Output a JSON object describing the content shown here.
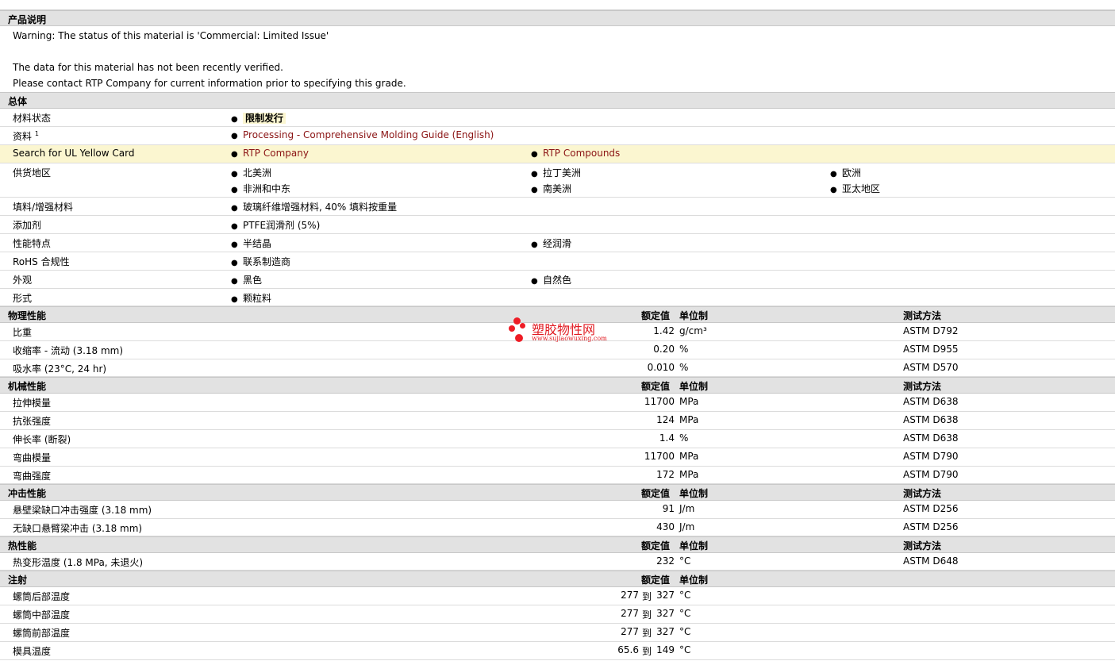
{
  "desc": {
    "title": "产品说明",
    "warning": "Warning: The status of this material is 'Commercial: Limited Issue'",
    "line2": "The data for this material has not been recently verified.",
    "line3": "Please contact RTP Company for current information prior to specifying this grade."
  },
  "general": {
    "title": "总体",
    "status_label": "材料状态",
    "status_value": "限制发行",
    "docs_label": "资料",
    "docs_sup": "1",
    "docs_link": "Processing - Comprehensive Molding Guide (English)",
    "ul_label": "Search for UL Yellow Card",
    "ul_link1": "RTP Company",
    "ul_link2": "RTP Compounds",
    "region_label": "供货地区",
    "regions": [
      "北美洲",
      "拉丁美洲",
      "欧洲",
      "非洲和中东",
      "南美洲",
      "亚太地区"
    ],
    "filler_label": "填料/增强材料",
    "filler_value": "玻璃纤维增强材料, 40% 填料按重量",
    "additive_label": "添加剂",
    "additive_value": "PTFE润滑剂 (5%)",
    "features_label": "性能特点",
    "features": [
      "半结晶",
      "经润滑"
    ],
    "rohs_label": "RoHS 合规性",
    "rohs_value": "联系制造商",
    "appearance_label": "外观",
    "appearance": [
      "黑色",
      "自然色"
    ],
    "form_label": "形式",
    "form_value": "颗粒料"
  },
  "headers": {
    "nominal": "额定值",
    "unit": "单位制",
    "method": "测试方法"
  },
  "physical": {
    "title": "物理性能",
    "rows": [
      {
        "label": "比重",
        "value": "1.42",
        "unit": "g/cm³",
        "method": "ASTM D792"
      },
      {
        "label": "收缩率 - 流动 (3.18 mm)",
        "value": "0.20",
        "unit": "%",
        "method": "ASTM D955"
      },
      {
        "label": "吸水率 (23°C, 24 hr)",
        "value": "0.010",
        "unit": "%",
        "method": "ASTM D570"
      }
    ]
  },
  "mechanical": {
    "title": "机械性能",
    "rows": [
      {
        "label": "拉伸模量",
        "value": "11700",
        "unit": "MPa",
        "method": "ASTM D638"
      },
      {
        "label": "抗张强度",
        "value": "124",
        "unit": "MPa",
        "method": "ASTM D638"
      },
      {
        "label": "伸长率 (断裂)",
        "value": "1.4",
        "unit": "%",
        "method": "ASTM D638"
      },
      {
        "label": "弯曲模量",
        "value": "11700",
        "unit": "MPa",
        "method": "ASTM D790"
      },
      {
        "label": "弯曲强度",
        "value": "172",
        "unit": "MPa",
        "method": "ASTM D790"
      }
    ]
  },
  "impact": {
    "title": "冲击性能",
    "rows": [
      {
        "label": "悬壁梁缺口冲击强度 (3.18 mm)",
        "value": "91",
        "unit": "J/m",
        "method": "ASTM D256"
      },
      {
        "label": "无缺口悬臂梁冲击 (3.18 mm)",
        "value": "430",
        "unit": "J/m",
        "method": "ASTM D256"
      }
    ]
  },
  "thermal": {
    "title": "热性能",
    "rows": [
      {
        "label": "热变形温度 (1.8 MPa, 未退火)",
        "value": "232",
        "unit": "°C",
        "method": "ASTM D648"
      }
    ]
  },
  "injection": {
    "title": "注射",
    "range_word": "到",
    "rows": [
      {
        "label": "螺筒后部温度",
        "low": "277",
        "high": "327",
        "unit": "°C"
      },
      {
        "label": "螺筒中部温度",
        "low": "277",
        "high": "327",
        "unit": "°C"
      },
      {
        "label": "螺筒前部温度",
        "low": "277",
        "high": "327",
        "unit": "°C"
      },
      {
        "label": "模具温度",
        "low": "65.6",
        "high": "149",
        "unit": "°C"
      }
    ]
  },
  "watermark": {
    "text": "塑胶物性网",
    "url": "www.sujiaowuxing.com",
    "color": "#e11b22"
  }
}
